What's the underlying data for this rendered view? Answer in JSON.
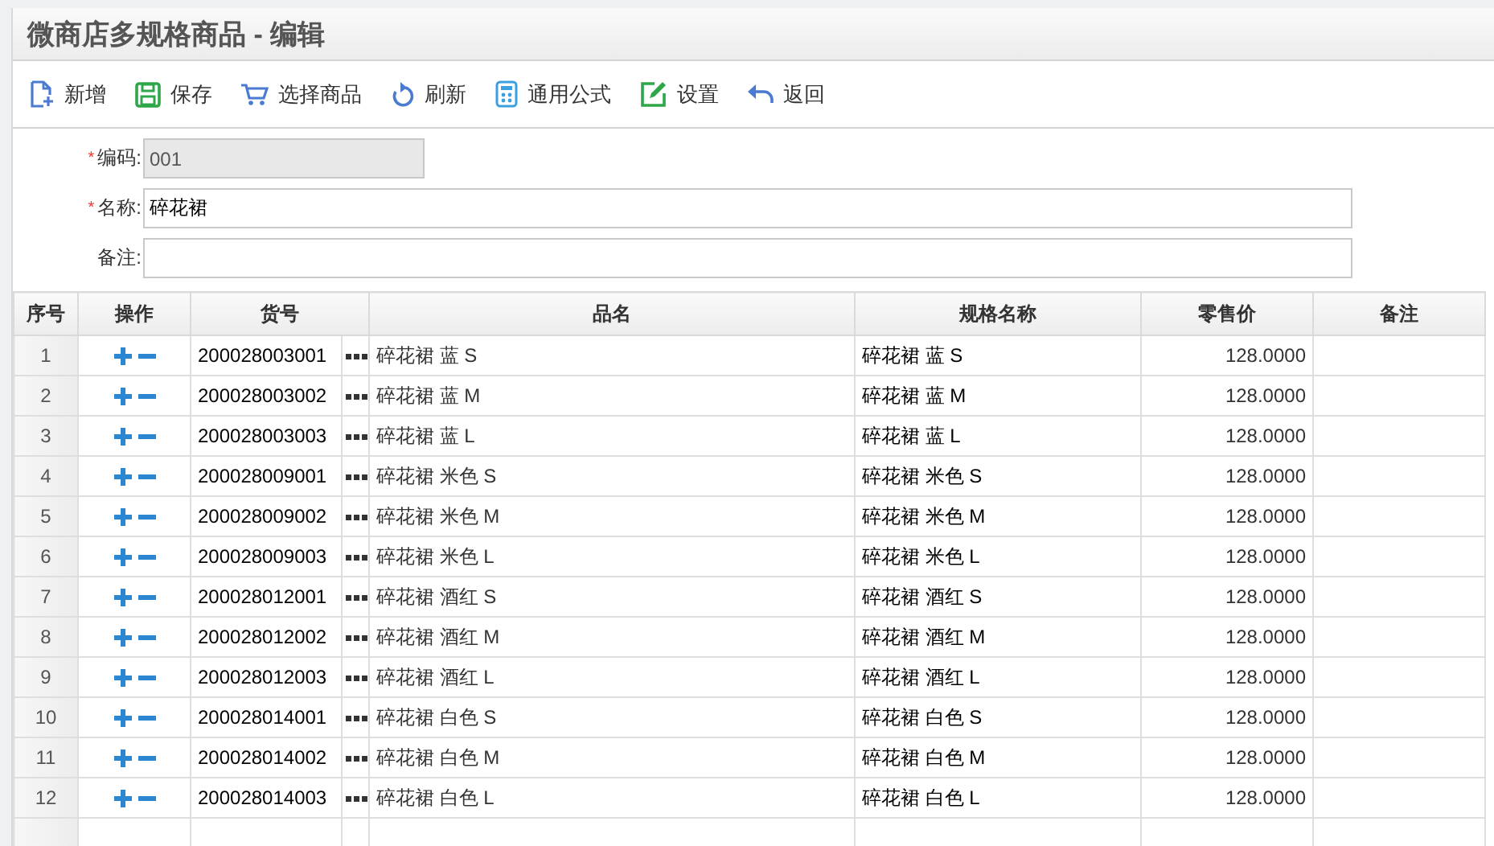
{
  "window": {
    "title": "微商店多规格商品 - 编辑"
  },
  "toolbar": [
    {
      "label": "新增"
    },
    {
      "label": "保存"
    },
    {
      "label": "选择商品"
    },
    {
      "label": "刷新"
    },
    {
      "label": "通用公式"
    },
    {
      "label": "设置"
    },
    {
      "label": "返回"
    }
  ],
  "form": [
    {
      "required_mark": "*",
      "label": "编码:",
      "value": "001",
      "disabled": true
    },
    {
      "required_mark": "*",
      "label": "名称:",
      "value": "碎花裙",
      "disabled": false
    },
    {
      "label": "备注:",
      "disabled": false
    }
  ],
  "table": {
    "columns": [
      "序号",
      "操作",
      "货号",
      "品名",
      "规格名称",
      "零售价",
      "备注"
    ],
    "rows": [
      {
        "index": "1",
        "code": "200028003001",
        "name": "碎花裙 蓝 S",
        "spec": "碎花裙 蓝 S",
        "price": "128.0000"
      },
      {
        "index": "2",
        "code": "200028003002",
        "name": "碎花裙 蓝 M",
        "spec": "碎花裙 蓝 M",
        "price": "128.0000"
      },
      {
        "index": "3",
        "code": "200028003003",
        "name": "碎花裙 蓝 L",
        "spec": "碎花裙 蓝 L",
        "price": "128.0000"
      },
      {
        "index": "4",
        "code": "200028009001",
        "name": "碎花裙 米色 S",
        "spec": "碎花裙 米色 S",
        "price": "128.0000"
      },
      {
        "index": "5",
        "code": "200028009002",
        "name": "碎花裙 米色 M",
        "spec": "碎花裙 米色 M",
        "price": "128.0000"
      },
      {
        "index": "6",
        "code": "200028009003",
        "name": "碎花裙 米色 L",
        "spec": "碎花裙 米色 L",
        "price": "128.0000"
      },
      {
        "index": "7",
        "code": "200028012001",
        "name": "碎花裙 酒红 S",
        "spec": "碎花裙 酒红 S",
        "price": "128.0000"
      },
      {
        "index": "8",
        "code": "200028012002",
        "name": "碎花裙 酒红 M",
        "spec": "碎花裙 酒红 M",
        "price": "128.0000"
      },
      {
        "index": "9",
        "code": "200028012003",
        "name": "碎花裙 酒红 L",
        "spec": "碎花裙 酒红 L",
        "price": "128.0000"
      },
      {
        "index": "10",
        "code": "200028014001",
        "name": "碎花裙 白色 S",
        "spec": "碎花裙 白色 S",
        "price": "128.0000"
      },
      {
        "index": "11",
        "code": "200028014002",
        "name": "碎花裙 白色 M",
        "spec": "碎花裙 白色 M",
        "price": "128.0000"
      },
      {
        "index": "12",
        "code": "200028014003",
        "name": "碎花裙 白色 L",
        "spec": "碎花裙 白色 L",
        "price": "128.0000"
      }
    ]
  }
}
